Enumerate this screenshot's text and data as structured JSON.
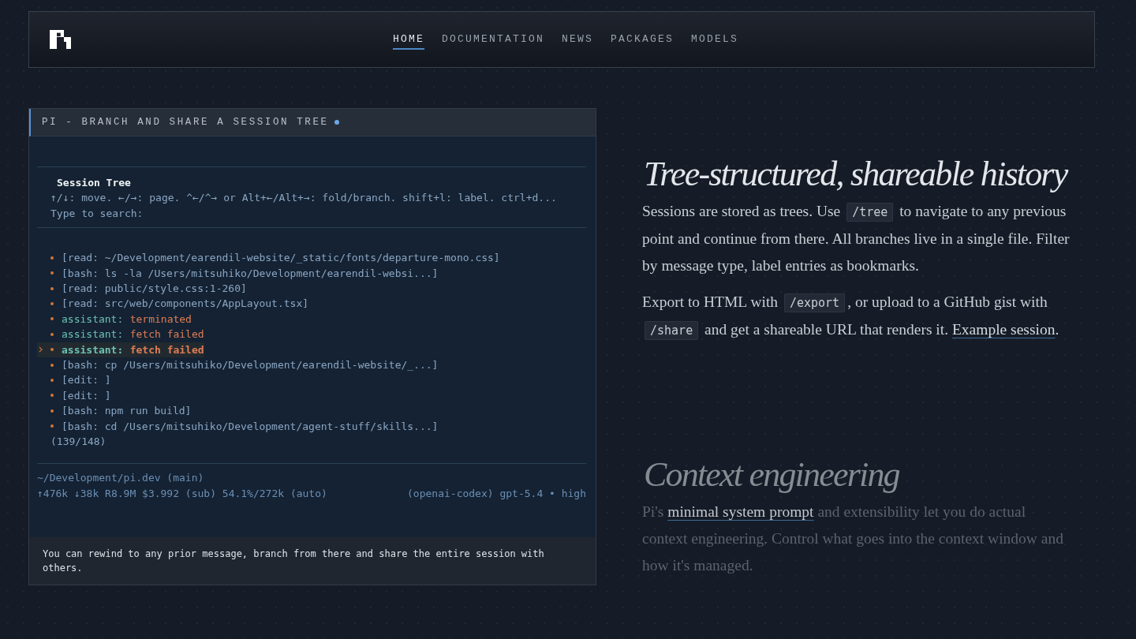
{
  "header": {
    "nav": [
      {
        "label": "HOME",
        "selected": true
      },
      {
        "label": "DOCUMENTATION",
        "selected": false
      },
      {
        "label": "NEWS",
        "selected": false
      },
      {
        "label": "PACKAGES",
        "selected": false
      },
      {
        "label": "MODELS",
        "selected": false
      }
    ]
  },
  "demo": {
    "title": "PI - BRANCH AND SHARE A SESSION TREE",
    "live": true,
    "tree_title": "Session Tree",
    "help": "↑/↓: move. ←/→: page. ^←/^→ or Alt+←/Alt+→: fold/branch. shift+l: label. ctrl+d...",
    "search_prompt": "Type to search:",
    "items": [
      {
        "kind": "tool",
        "text": "[read: ~/Development/earendil-website/_static/fonts/departure-mono.css]",
        "selected": false
      },
      {
        "kind": "tool",
        "text": "[bash: ls -la /Users/mitsuhiko/Development/earendil-websi...]",
        "selected": false
      },
      {
        "kind": "tool",
        "text": "[read: public/style.css:1-260]",
        "selected": false
      },
      {
        "kind": "tool",
        "text": "[read: src/web/components/AppLayout.tsx]",
        "selected": false
      },
      {
        "kind": "message",
        "role": "assistant:",
        "text": "terminated",
        "selected": false
      },
      {
        "kind": "message",
        "role": "assistant:",
        "text": "fetch failed",
        "selected": false
      },
      {
        "kind": "message",
        "role": "assistant:",
        "text": "fetch failed",
        "selected": true
      },
      {
        "kind": "tool",
        "text": "[bash: cp /Users/mitsuhiko/Development/earendil-website/_...]",
        "selected": false
      },
      {
        "kind": "tool",
        "text": "[edit: ]",
        "selected": false
      },
      {
        "kind": "tool",
        "text": "[edit: ]",
        "selected": false
      },
      {
        "kind": "tool",
        "text": "[bash: npm run build]",
        "selected": false
      },
      {
        "kind": "tool",
        "text": "[bash: cd /Users/mitsuhiko/Development/agent-stuff/skills...]",
        "selected": false
      }
    ],
    "count": "(139/148)",
    "cwd": "~/Development/pi.dev (main)",
    "stats": "↑476k ↓38k R8.9M $3.992 (sub) 54.1%/272k (auto)",
    "model": "(openai-codex) gpt-5.4 • high",
    "caption": "You can rewind to any prior message, branch from there and share the entire session with others."
  },
  "sections": [
    {
      "heading": "Tree-structured, shareable history",
      "dimmed": false,
      "paragraphs": [
        [
          {
            "kind": "text",
            "text": "Sessions are stored as trees. Use "
          },
          {
            "kind": "code",
            "text": "/tree"
          },
          {
            "kind": "text",
            "text": " to navigate to any previous point and continue from there. All branches live in a single file. Filter by message type, label entries as bookmarks."
          }
        ],
        [
          {
            "kind": "text",
            "text": "Export to HTML with "
          },
          {
            "kind": "code",
            "text": "/export"
          },
          {
            "kind": "text",
            "text": ", or upload to a GitHub gist with "
          },
          {
            "kind": "code",
            "text": "/share"
          },
          {
            "kind": "text",
            "text": " and get a shareable URL that renders it. "
          },
          {
            "kind": "link",
            "text": "Example session"
          },
          {
            "kind": "text",
            "text": "."
          }
        ]
      ]
    },
    {
      "heading": "Context engineering",
      "dimmed": true,
      "paragraphs": [
        [
          {
            "kind": "text",
            "text": "Pi's "
          },
          {
            "kind": "link",
            "text": "minimal system prompt"
          },
          {
            "kind": "text",
            "text": " and extensibility let you do actual context engineering. Control what goes into the context window and how it's managed."
          }
        ]
      ]
    }
  ]
}
